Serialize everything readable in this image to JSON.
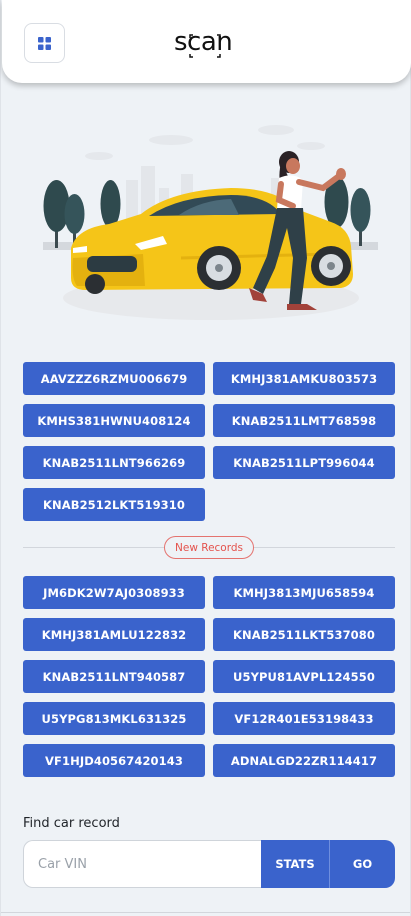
{
  "app": {
    "logo_text": "scan"
  },
  "colors": {
    "accent": "#3a63cc",
    "new_records": "#e4534d",
    "car": "#f5c518",
    "background": "#eef2f6"
  },
  "icons": {
    "menu": "grid-icon"
  },
  "records": [
    "AAVZZZ6RZMU006679",
    "KMHJ381AMKU803573",
    "KMHS381HWNU408124",
    "KNAB2511LMT768598",
    "KNAB2511LNT966269",
    "KNAB2511LPT996044",
    "KNAB2512LKT519310"
  ],
  "new_records_label": "New Records",
  "new_records": [
    "JM6DK2W7AJ0308933",
    "KMHJ3813MJU658594",
    "KMHJ381AMLU122832",
    "KNAB2511LKT537080",
    "KNAB2511LNT940587",
    "U5YPU81AVPL124550",
    "U5YPG813MKL631325",
    "VF12R401E53198433",
    "VF1HJD40567420143",
    "ADNALGD22ZR114417"
  ],
  "search": {
    "label": "Find car record",
    "placeholder": "Car VIN",
    "stats_label": "STATS",
    "go_label": "GO"
  }
}
